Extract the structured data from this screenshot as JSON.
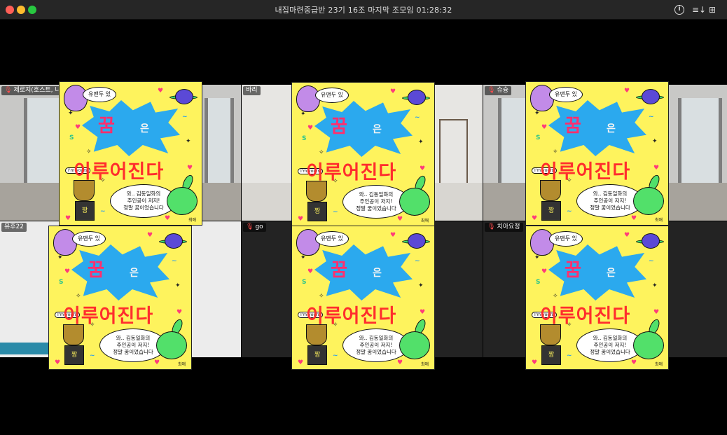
{
  "window": {
    "title": "내집마련중급반 23기 16조 마지막 조모임 01:28:32",
    "info_icon": "info-circle-icon",
    "sort_icon": "sort-list-icon",
    "grid_icon": "grid-view-icon",
    "info_glyph": "i",
    "sort_glyph": "≡↓",
    "grid_glyph": "⊞"
  },
  "participants": [
    {
      "name": "제로지(호스트, 나)",
      "muted": true,
      "active": false
    },
    {
      "name": "바리",
      "muted": false,
      "active": true
    },
    {
      "name": "슈슝",
      "muted": true,
      "active": false
    },
    {
      "name": "유후22",
      "muted": false,
      "active": false
    },
    {
      "name": "go",
      "muted": true,
      "active": false
    },
    {
      "name": "치아요정",
      "muted": true,
      "active": false
    }
  ],
  "mic_glyph": "🎙",
  "sticker": {
    "bubble_top": "유맨두 있",
    "dream": "꿈",
    "eun": "은",
    "main_phrase": "이루어진다",
    "im_tag": "I'm yours",
    "trophy_label": "짱",
    "bubble_bottom_line1": "와.. 김동일화의",
    "bubble_bottom_line2": "주인공이 저지!",
    "bubble_bottom_line3": "정말 꿈이었습니다",
    "signature": "최애"
  }
}
